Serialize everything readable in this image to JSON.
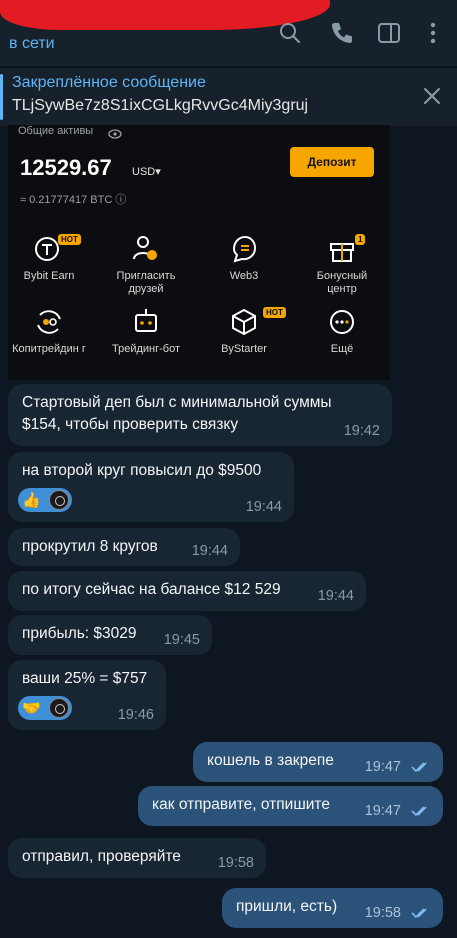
{
  "header": {
    "status": "в сети",
    "icons": [
      "search-icon",
      "phone-icon",
      "sidebar-icon",
      "more-icon"
    ]
  },
  "pinned": {
    "title": "Закреплённое сообщение",
    "text": "TLjSywBe7z8S1ixCGLkgRvvGc4Miy3gruj"
  },
  "screenshot": {
    "assets_label": "Общие активы",
    "amount": "12529.67",
    "currency": "USD▾",
    "btc": "≈ 0.21777417  BTC ⓘ",
    "deposit_label": "Депозит",
    "tiles": [
      {
        "label": "Bybit Earn",
        "icon": "earn-icon",
        "badge": "HOT"
      },
      {
        "label": "Пригласить друзей",
        "icon": "invite-icon",
        "badge": ""
      },
      {
        "label": "Web3",
        "icon": "web3-icon",
        "badge": ""
      },
      {
        "label": "Бонусный центр",
        "icon": "gift-icon",
        "badge": "1"
      },
      {
        "label": "Копитрейдин г",
        "icon": "copytrade-icon",
        "badge": ""
      },
      {
        "label": "Трейдинг-бот",
        "icon": "bot-icon",
        "badge": ""
      },
      {
        "label": "ByStarter",
        "icon": "cube-icon",
        "badge": "HOT"
      },
      {
        "label": "Ещё",
        "icon": "more-dots-icon",
        "badge": ""
      }
    ]
  },
  "messages": [
    {
      "dir": "in",
      "text": "Стартовый деп был с минимальной суммы $154, чтобы проверить связку",
      "time": "19:42"
    },
    {
      "dir": "in",
      "text": "на второй круг повысил до $9500",
      "time": "19:44",
      "reaction": "👍"
    },
    {
      "dir": "in",
      "text": "прокрутил 8 кругов",
      "time": "19:44"
    },
    {
      "dir": "in",
      "text": "по итогу сейчас на балансе $12 529",
      "time": "19:44"
    },
    {
      "dir": "in",
      "text": "прибыль: $3029",
      "time": "19:45"
    },
    {
      "dir": "in",
      "text": "ваши 25% = $757",
      "time": "19:46",
      "reaction": "🤝"
    },
    {
      "dir": "out",
      "text": "кошель в закрепе",
      "time": "19:47"
    },
    {
      "dir": "out",
      "text": "как отправите, отпишите",
      "time": "19:47"
    },
    {
      "dir": "in",
      "text": "отправил, проверяйте",
      "time": "19:58"
    },
    {
      "dir": "out",
      "text": "пришли, есть)",
      "time": "19:58"
    }
  ],
  "colors": {
    "background": "#0e1621",
    "incoming": "#182533",
    "outgoing": "#2b5278",
    "accent": "#5eb5f7",
    "deposit": "#f7a600"
  }
}
